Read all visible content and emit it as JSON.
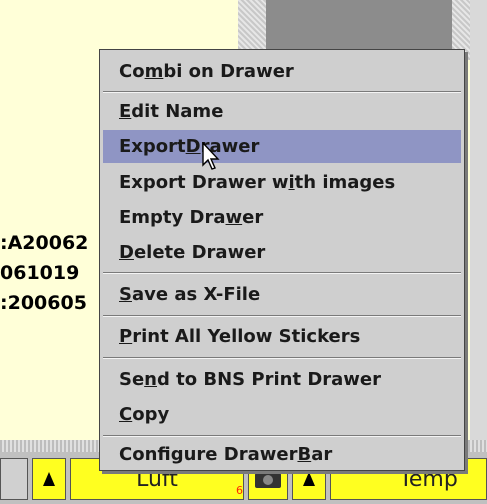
{
  "background_text": {
    "left_lines": [
      ":A20062",
      "061019",
      ":200605"
    ]
  },
  "bottom_bar": {
    "luft_label": "Luft",
    "temp_label": "Temp",
    "badge_number": "6"
  },
  "menu": {
    "items": [
      {
        "pre": "Co",
        "mn": "m",
        "post": "bi on Drawer"
      },
      {
        "pre": "",
        "mn": "E",
        "post": "dit Name"
      },
      {
        "pre": "Export ",
        "mn": "D",
        "post": "rawer"
      },
      {
        "pre": "Export Drawer w",
        "mn": "i",
        "post": "th images"
      },
      {
        "pre": "Empty Dra",
        "mn": "w",
        "post": "er"
      },
      {
        "pre": "",
        "mn": "D",
        "post": "elete Drawer"
      },
      {
        "pre": "",
        "mn": "S",
        "post": "ave as X-File"
      },
      {
        "pre": "",
        "mn": "P",
        "post": "rint All Yellow Stickers"
      },
      {
        "pre": "Se",
        "mn": "n",
        "post": "d to BNS Print Drawer"
      },
      {
        "pre": "",
        "mn": "C",
        "post": "opy"
      },
      {
        "pre": "Configure Drawer ",
        "mn": "B",
        "post": "ar"
      }
    ],
    "highlighted_index": 2
  },
  "colors": {
    "menu_bg": "#cfcfcf",
    "highlight": "#8f95c4",
    "page_bg": "#ffffd8",
    "button_yellow": "#ffff20"
  }
}
